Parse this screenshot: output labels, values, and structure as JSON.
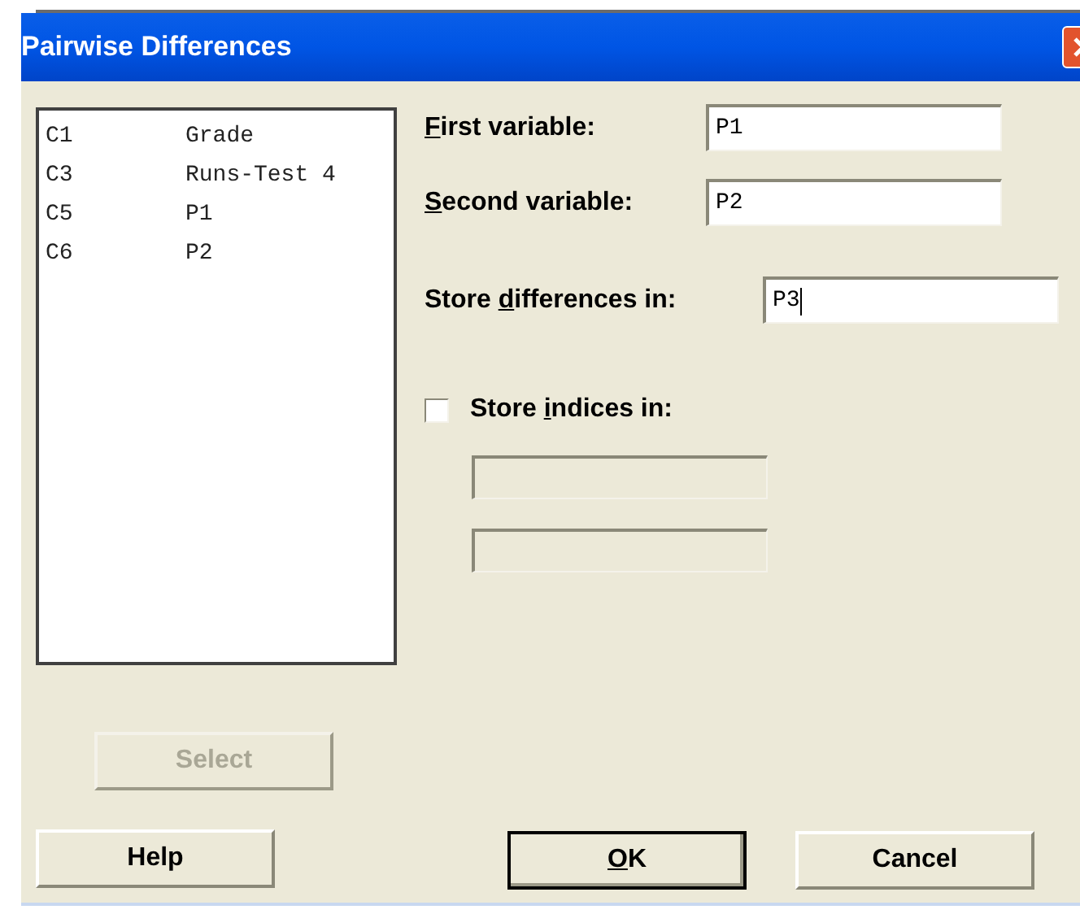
{
  "window": {
    "title": "Pairwise Differences"
  },
  "columns_list": [
    {
      "column": "C1",
      "name": "Grade"
    },
    {
      "column": "C3",
      "name": "Runs-Test 4"
    },
    {
      "column": "C5",
      "name": "P1"
    },
    {
      "column": "C6",
      "name": "P2"
    }
  ],
  "fields": [
    {
      "label": {
        "key": "F",
        "post": "irst variable:"
      },
      "value": "P1",
      "focused": false
    },
    {
      "label": {
        "key": "S",
        "post": "econd variable:"
      },
      "value": "P2",
      "focused": false
    },
    {
      "label": {
        "pre": "Store ",
        "key": "d",
        "post": "ifferences in:"
      },
      "value": "P3",
      "focused": true
    }
  ],
  "store_indices": {
    "label": {
      "pre": "Store ",
      "key": "i",
      "post": "ndices in:"
    },
    "checked": false
  },
  "buttons": [
    {
      "kind": "select",
      "label": {
        "post": "Select"
      },
      "disabled": true,
      "default": false
    },
    {
      "kind": "help",
      "label": {
        "post": "Help"
      },
      "disabled": false,
      "default": false
    },
    {
      "kind": "ok",
      "label": {
        "key": "O",
        "post": "K"
      },
      "disabled": false,
      "default": true
    },
    {
      "kind": "cancel",
      "label": {
        "post": "Cancel"
      },
      "disabled": false,
      "default": false
    }
  ]
}
